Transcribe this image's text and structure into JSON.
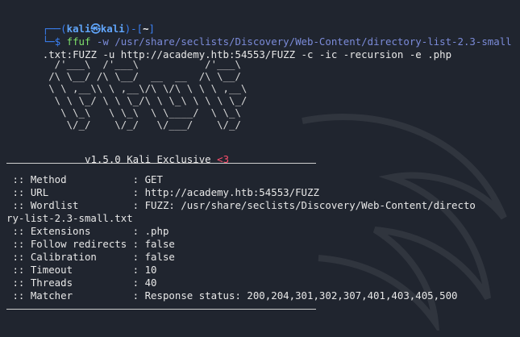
{
  "prompt": {
    "top_frame": "┌──(",
    "user": "kali",
    "skull": "㉿",
    "host": "kali",
    "close_user": ")-[",
    "cwd": "~",
    "close_cwd": "]",
    "bottom_frame": "└─",
    "dollar": "$ "
  },
  "command": {
    "program": "ffuf",
    "part1": " -w /usr/share/seclists/Discovery/Web-Content/directory-list-2.3-small",
    "part2": ".txt:FUZZ -u http://academy.htb:54553/FUZZ -c -ic -recursion -e .php"
  },
  "banner": {
    "art": "        /'___\\  /'___\\           /'___\\\n       /\\ \\__/ /\\ \\__/  __  __  /\\ \\__/\n       \\ \\ ,__\\\\ \\ ,__\\/\\ \\/\\ \\ \\ \\ ,__\\\n        \\ \\ \\_/ \\ \\ \\_/\\ \\ \\_\\ \\ \\ \\ \\_/\n         \\ \\_\\   \\ \\_\\  \\ \\____/  \\ \\_\\\n          \\/_/    \\/_/   \\/___/    \\/_/",
    "version": "       v1.5.0 Kali Exclusive ",
    "heart": "<3"
  },
  "config": [
    " :: Method           : GET",
    " :: URL              : http://academy.htb:54553/FUZZ",
    " :: Wordlist         : FUZZ: /usr/share/seclists/Discovery/Web-Content/directo",
    "ry-list-2.3-small.txt",
    " :: Extensions       : .php",
    " :: Follow redirects : false",
    " :: Calibration      : false",
    " :: Timeout          : 10",
    " :: Threads          : 40",
    " :: Matcher          : Response status: 200,204,301,302,307,401,403,405,500"
  ],
  "colors": {
    "background": "#20252f",
    "prompt": "#3b82f6",
    "program": "#7ee06b",
    "option": "#7b8bd9",
    "heart": "#ff4f6d"
  }
}
